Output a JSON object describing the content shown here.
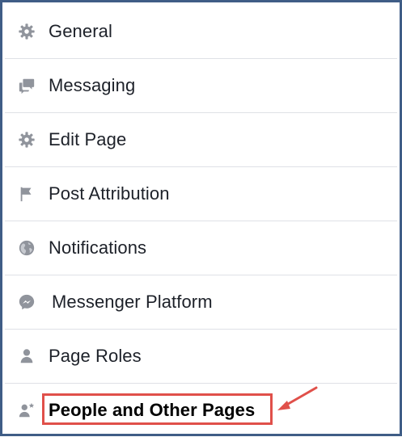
{
  "menu": {
    "items": [
      {
        "label": "General",
        "icon": "gear-icon"
      },
      {
        "label": "Messaging",
        "icon": "chat-bubbles-icon"
      },
      {
        "label": "Edit Page",
        "icon": "gear-icon"
      },
      {
        "label": "Post Attribution",
        "icon": "flag-icon"
      },
      {
        "label": "Notifications",
        "icon": "globe-icon"
      },
      {
        "label": "Messenger Platform",
        "icon": "messenger-icon"
      },
      {
        "label": "Page Roles",
        "icon": "person-icon"
      },
      {
        "label": "People and Other Pages",
        "icon": "person-star-icon"
      }
    ]
  },
  "colors": {
    "frame_border": "#3f5d86",
    "icon_gray": "#90949c",
    "highlight_red": "#e0504a",
    "divider": "#dfe1e6"
  }
}
